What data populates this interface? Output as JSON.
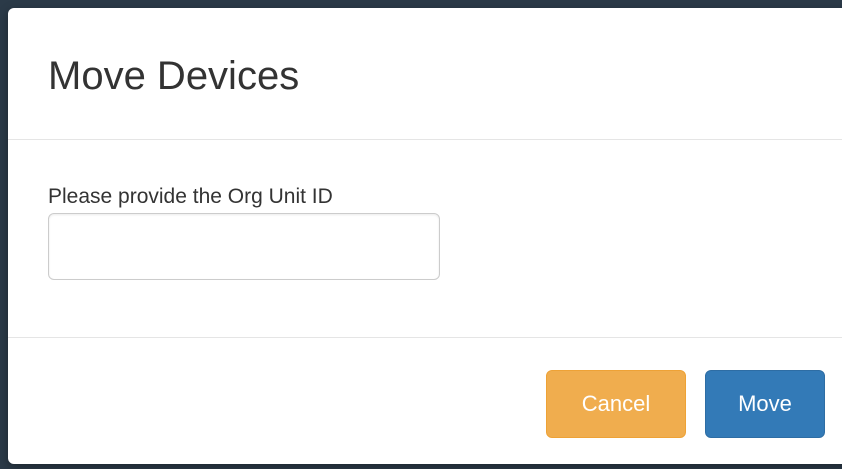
{
  "dialog": {
    "title": "Move Devices",
    "field_label": "Please provide the Org Unit ID",
    "field_value": "",
    "field_placeholder": "",
    "cancel_label": "Cancel",
    "move_label": "Move"
  },
  "colors": {
    "cancel_button": "#f0ad4e",
    "move_button": "#337ab7"
  }
}
